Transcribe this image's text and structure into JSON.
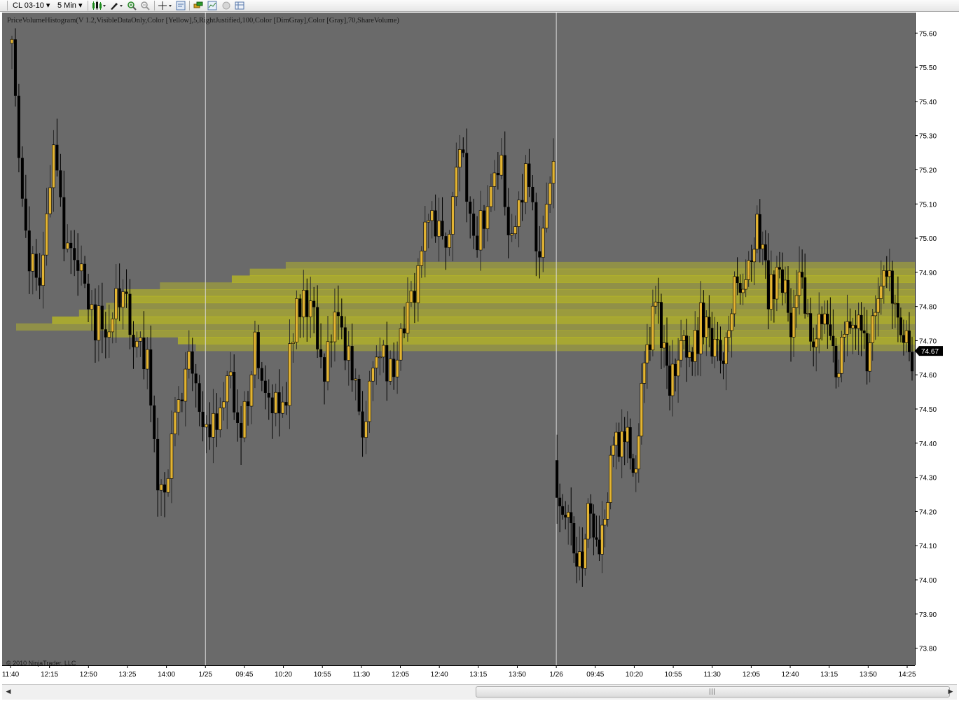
{
  "toolbar": {
    "instrument": "CL 03-10",
    "interval": "5 Min",
    "icons": [
      "bars-type-icon",
      "draw-pencil-icon",
      "zoom-in-icon",
      "zoom-out-icon",
      "crosshair-icon",
      "data-box-icon",
      "instrument-link-icon",
      "chart-properties-icon",
      "circle-icon",
      "grid-icon"
    ]
  },
  "chart": {
    "indicator_label": "PriceVolumeHistogram(V 1.2,VisibleDataOnly,Color [Yellow],5,RightJustified,100,Color [DimGray],Color [Gray],70,ShareVolume)",
    "copyright": "© 2010 NinjaTrader, LLC",
    "current_price": "74.67",
    "colors": {
      "background": "#6a6a6a",
      "histogram": "#e0e000",
      "up_candle": "#e3b432",
      "down_candle": "#000000",
      "price_marker": "#000000"
    }
  },
  "chart_data": {
    "type": "candlestick",
    "ylim": [
      73.75,
      75.66
    ],
    "y_ticks": [
      "75.60",
      "75.50",
      "75.40",
      "75.30",
      "75.20",
      "75.10",
      "75.00",
      "74.90",
      "74.80",
      "74.70",
      "74.60",
      "74.50",
      "74.40",
      "74.30",
      "74.20",
      "74.10",
      "74.00",
      "73.90",
      "73.80"
    ],
    "x_ticks": [
      "11:40",
      "12:15",
      "12:50",
      "13:25",
      "14:00",
      "1/25",
      "09:45",
      "10:20",
      "10:55",
      "11:30",
      "12:05",
      "12:40",
      "13:15",
      "13:50",
      "1/26",
      "09:45",
      "10:20",
      "10:55",
      "11:30",
      "12:05",
      "12:40",
      "13:15",
      "13:50",
      "14:25"
    ],
    "session_breaks": [
      "1/25",
      "1/26"
    ],
    "price_volume_histogram_levels": [
      74.92,
      74.9,
      74.88,
      74.86,
      74.84,
      74.82,
      74.8,
      74.78,
      74.76,
      74.74,
      74.72,
      74.7,
      74.68
    ],
    "segments": [
      {
        "from": 75.57,
        "path": [
          75.55,
          74.98,
          74.84,
          75.25,
          74.97,
          74.92,
          74.75,
          74.77,
          74.85,
          74.73,
          74.63,
          74.22,
          74.42,
          74.68,
          74.5,
          74.43,
          74.64,
          74.42,
          74.71,
          74.55,
          74.48,
          74.78,
          74.84,
          74.62,
          74.75,
          74.65,
          74.45,
          74.7,
          74.6,
          74.75,
          74.9,
          75.1,
          74.95,
          75.3,
          74.97,
          75.08,
          75.22,
          74.98,
          75.18,
          74.9,
          75.25
        ]
      },
      {
        "from": 74.35,
        "path": [
          74.3,
          74.15,
          74.02,
          74.22,
          74.1,
          74.35,
          74.45,
          74.3,
          74.65,
          74.8,
          74.55,
          74.7,
          74.62,
          74.76,
          74.7,
          74.63,
          74.88,
          74.82,
          75.05,
          74.84,
          74.9,
          74.76,
          74.87,
          74.72,
          74.78,
          74.62,
          74.7,
          74.75,
          74.65,
          74.8,
          74.9,
          74.72,
          74.67
        ]
      }
    ]
  }
}
